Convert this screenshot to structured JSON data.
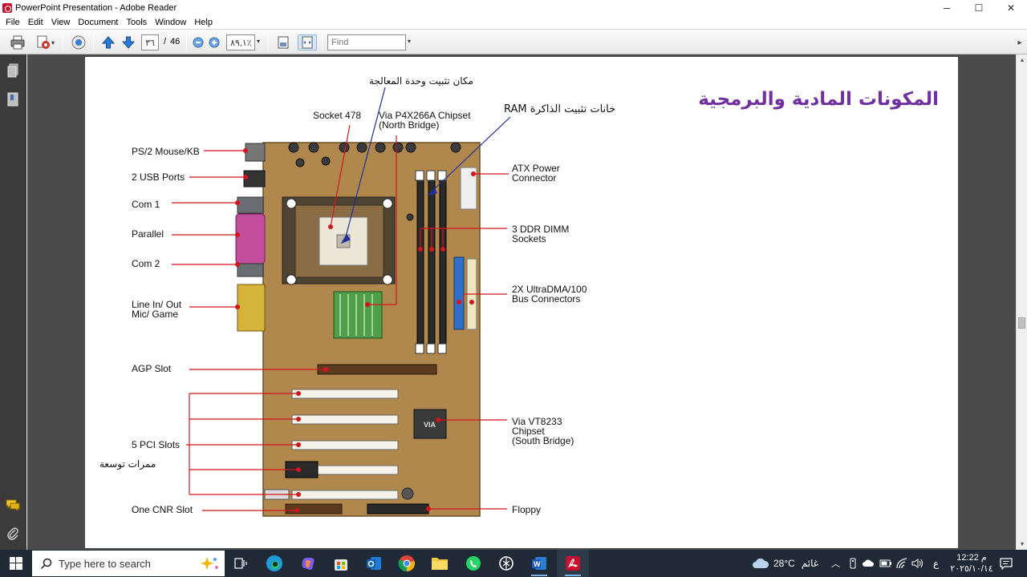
{
  "window": {
    "title": "PowerPoint Presentation - Adobe Reader",
    "controls": {
      "minimize": "─",
      "maximize": "☐",
      "close": "✕"
    }
  },
  "menu": [
    "File",
    "Edit",
    "View",
    "Document",
    "Tools",
    "Window",
    "Help"
  ],
  "toolbar": {
    "page_current": "٣٦",
    "page_sep": "/",
    "page_total": "46",
    "zoom": "٨٩,١٪",
    "find_placeholder": "Find"
  },
  "slide": {
    "title": "المكونات المادية والبرمجية",
    "labels_left": {
      "ps2": "PS/2 Mouse/KB",
      "usb": "2 USB Ports",
      "com1": "Com 1",
      "parallel": "Parallel",
      "com2": "Com 2",
      "linein": "Line In/ Out",
      "micgame": "Mic/ Game",
      "agp": "AGP Slot",
      "pci": "5 PCI Slots",
      "pci_ar": "ممرات توسعة",
      "cnr": "One CNR Slot"
    },
    "labels_top": {
      "cpu_ar": "مكان تثبيت وحدة المعالجة",
      "socket": "Socket 478",
      "northbridge_1": "Via P4X266A Chipset",
      "northbridge_2": "(North Bridge)",
      "ram_ar": "خانات تثبيت الذاكرة RAM"
    },
    "labels_right": {
      "atx_1": "ATX Power",
      "atx_2": "Connector",
      "ddr_1": "3 DDR DIMM",
      "ddr_2": "Sockets",
      "ultra_1": "2X UltraDMA/100",
      "ultra_2": "Bus Connectors",
      "vt_1": "Via VT8233",
      "vt_2": "Chipset",
      "vt_3": "(South Bridge)",
      "floppy": "Floppy"
    }
  },
  "taskbar": {
    "search_placeholder": "Type here to search",
    "weather_temp": "28°C",
    "weather_text": "غائم",
    "lang": "ع",
    "time": "12:22 م",
    "date": "٢٠٢٥/١٠/١٤"
  },
  "colors": {
    "title_purple": "#7030a0",
    "leader_red": "#d4141c",
    "leader_blue": "#1f2f9a",
    "board": "#b0884e",
    "taskbar": "#1f2a36",
    "docbg": "#4b4b4b"
  }
}
